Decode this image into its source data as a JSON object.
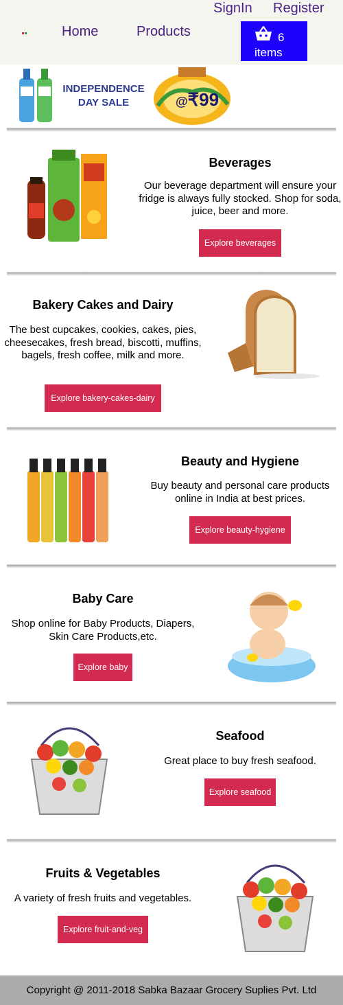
{
  "header": {
    "nav": {
      "home": "Home",
      "products": "Products"
    },
    "auth": {
      "signin": "SignIn",
      "register": "Register"
    },
    "cart": {
      "count": "6",
      "label": "items",
      "icon": "basket-icon"
    },
    "colors": {
      "nav_text": "#4a2383",
      "cart_bg": "#1e00ff"
    }
  },
  "banner": {
    "title_line1": "INDEPENDENCE",
    "title_line2": "DAY SALE",
    "price_prefix": "@",
    "price": "₹99"
  },
  "categories": [
    {
      "title": "Beverages",
      "description": "Our beverage department will ensure your fridge is always fully stocked. Shop for soda, juice, beer and more.",
      "button": "Explore beverages"
    },
    {
      "title": "Bakery Cakes and Dairy",
      "description": "The best cupcakes, cookies, cakes, pies, cheesecakes, fresh bread, biscotti, muffins, bagels, fresh coffee, milk and more.",
      "button": "Explore bakery-cakes-dairy"
    },
    {
      "title": "Beauty and Hygiene",
      "description": "Buy beauty and personal care products online in India at best prices.",
      "button": "Explore beauty-hygiene"
    },
    {
      "title": "Baby Care",
      "description": "Shop online for Baby Products, Diapers, Skin Care Products,etc.",
      "button": "Explore baby"
    },
    {
      "title": "Seafood",
      "description": "Great place to buy fresh seafood.",
      "button": "Explore seafood"
    },
    {
      "title": "Fruits & Vegetables",
      "description": "A variety of fresh fruits and vegetables.",
      "button": "Explore fruit-and-veg"
    }
  ],
  "button_color": "#d32a4f",
  "footer": {
    "copyright": "Copyright @ 2011-2018 Sabka Bazaar Grocery Suplies Pvt. Ltd"
  }
}
